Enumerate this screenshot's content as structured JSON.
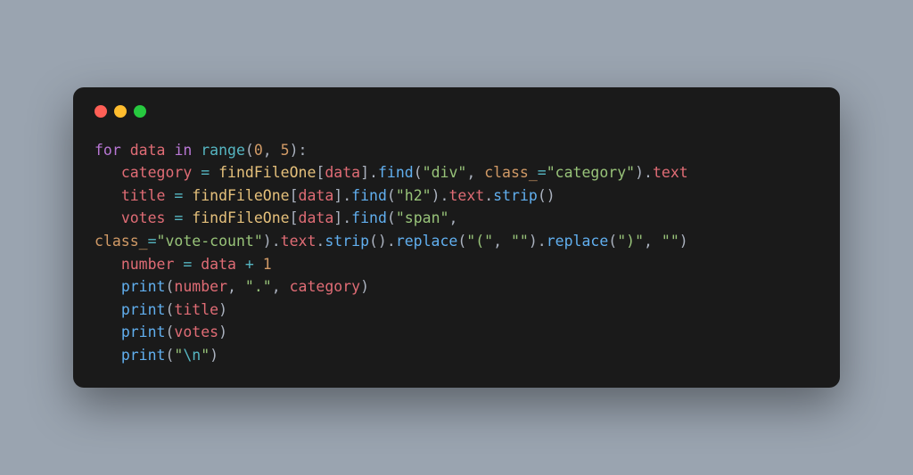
{
  "window": {
    "dots": [
      "red",
      "yellow",
      "green"
    ]
  },
  "code": {
    "tokens": [
      [
        {
          "text": "for",
          "cls": "kw-for"
        },
        {
          "text": " ",
          "cls": "punct"
        },
        {
          "text": "data",
          "cls": "var-data"
        },
        {
          "text": " ",
          "cls": "punct"
        },
        {
          "text": "in",
          "cls": "kw-in"
        },
        {
          "text": " ",
          "cls": "punct"
        },
        {
          "text": "range",
          "cls": "fn-range"
        },
        {
          "text": "(",
          "cls": "punct"
        },
        {
          "text": "0",
          "cls": "num"
        },
        {
          "text": ", ",
          "cls": "punct"
        },
        {
          "text": "5",
          "cls": "num"
        },
        {
          "text": "):",
          "cls": "punct"
        }
      ],
      [
        {
          "text": "   ",
          "cls": "punct"
        },
        {
          "text": "category",
          "cls": "var-name"
        },
        {
          "text": " ",
          "cls": "punct"
        },
        {
          "text": "=",
          "cls": "op"
        },
        {
          "text": " ",
          "cls": "punct"
        },
        {
          "text": "findFileOne",
          "cls": "obj"
        },
        {
          "text": "[",
          "cls": "punct"
        },
        {
          "text": "data",
          "cls": "var-data2"
        },
        {
          "text": "].",
          "cls": "punct"
        },
        {
          "text": "find",
          "cls": "method"
        },
        {
          "text": "(",
          "cls": "punct"
        },
        {
          "text": "\"div\"",
          "cls": "str"
        },
        {
          "text": ", ",
          "cls": "punct"
        },
        {
          "text": "class_",
          "cls": "kwarg"
        },
        {
          "text": "=",
          "cls": "op"
        },
        {
          "text": "\"category\"",
          "cls": "str"
        },
        {
          "text": ").",
          "cls": "punct"
        },
        {
          "text": "text",
          "cls": "attr"
        }
      ],
      [
        {
          "text": "   ",
          "cls": "punct"
        },
        {
          "text": "title",
          "cls": "var-name"
        },
        {
          "text": " ",
          "cls": "punct"
        },
        {
          "text": "=",
          "cls": "op"
        },
        {
          "text": " ",
          "cls": "punct"
        },
        {
          "text": "findFileOne",
          "cls": "obj"
        },
        {
          "text": "[",
          "cls": "punct"
        },
        {
          "text": "data",
          "cls": "var-data2"
        },
        {
          "text": "].",
          "cls": "punct"
        },
        {
          "text": "find",
          "cls": "method"
        },
        {
          "text": "(",
          "cls": "punct"
        },
        {
          "text": "\"h2\"",
          "cls": "str"
        },
        {
          "text": ").",
          "cls": "punct"
        },
        {
          "text": "text",
          "cls": "attr"
        },
        {
          "text": ".",
          "cls": "punct"
        },
        {
          "text": "strip",
          "cls": "method"
        },
        {
          "text": "()",
          "cls": "punct"
        }
      ],
      [
        {
          "text": "   ",
          "cls": "punct"
        },
        {
          "text": "votes",
          "cls": "var-name"
        },
        {
          "text": " ",
          "cls": "punct"
        },
        {
          "text": "=",
          "cls": "op"
        },
        {
          "text": " ",
          "cls": "punct"
        },
        {
          "text": "findFileOne",
          "cls": "obj"
        },
        {
          "text": "[",
          "cls": "punct"
        },
        {
          "text": "data",
          "cls": "var-data2"
        },
        {
          "text": "].",
          "cls": "punct"
        },
        {
          "text": "find",
          "cls": "method"
        },
        {
          "text": "(",
          "cls": "punct"
        },
        {
          "text": "\"span\"",
          "cls": "str"
        },
        {
          "text": ",",
          "cls": "punct"
        }
      ],
      [
        {
          "text": "class_",
          "cls": "kwarg"
        },
        {
          "text": "=",
          "cls": "op"
        },
        {
          "text": "\"vote-count\"",
          "cls": "str"
        },
        {
          "text": ").",
          "cls": "punct"
        },
        {
          "text": "text",
          "cls": "attr"
        },
        {
          "text": ".",
          "cls": "punct"
        },
        {
          "text": "strip",
          "cls": "method"
        },
        {
          "text": "().",
          "cls": "punct"
        },
        {
          "text": "replace",
          "cls": "method"
        },
        {
          "text": "(",
          "cls": "punct"
        },
        {
          "text": "\"(\"",
          "cls": "str"
        },
        {
          "text": ", ",
          "cls": "punct"
        },
        {
          "text": "\"\"",
          "cls": "str"
        },
        {
          "text": ").",
          "cls": "punct"
        },
        {
          "text": "replace",
          "cls": "method"
        },
        {
          "text": "(",
          "cls": "punct"
        },
        {
          "text": "\")\"",
          "cls": "str"
        },
        {
          "text": ", ",
          "cls": "punct"
        },
        {
          "text": "\"\"",
          "cls": "str"
        },
        {
          "text": ")",
          "cls": "punct"
        }
      ],
      [
        {
          "text": "   ",
          "cls": "punct"
        },
        {
          "text": "number",
          "cls": "var-name"
        },
        {
          "text": " ",
          "cls": "punct"
        },
        {
          "text": "=",
          "cls": "op"
        },
        {
          "text": " ",
          "cls": "punct"
        },
        {
          "text": "data",
          "cls": "var-data2"
        },
        {
          "text": " ",
          "cls": "punct"
        },
        {
          "text": "+",
          "cls": "op"
        },
        {
          "text": " ",
          "cls": "punct"
        },
        {
          "text": "1",
          "cls": "num"
        }
      ],
      [
        {
          "text": "   ",
          "cls": "punct"
        },
        {
          "text": "print",
          "cls": "fn-print"
        },
        {
          "text": "(",
          "cls": "punct"
        },
        {
          "text": "number",
          "cls": "var-name"
        },
        {
          "text": ", ",
          "cls": "punct"
        },
        {
          "text": "\".\"",
          "cls": "str"
        },
        {
          "text": ", ",
          "cls": "punct"
        },
        {
          "text": "category",
          "cls": "var-name"
        },
        {
          "text": ")",
          "cls": "punct"
        }
      ],
      [
        {
          "text": "   ",
          "cls": "punct"
        },
        {
          "text": "print",
          "cls": "fn-print"
        },
        {
          "text": "(",
          "cls": "punct"
        },
        {
          "text": "title",
          "cls": "var-name"
        },
        {
          "text": ")",
          "cls": "punct"
        }
      ],
      [
        {
          "text": "   ",
          "cls": "punct"
        },
        {
          "text": "print",
          "cls": "fn-print"
        },
        {
          "text": "(",
          "cls": "punct"
        },
        {
          "text": "votes",
          "cls": "var-name"
        },
        {
          "text": ")",
          "cls": "punct"
        }
      ],
      [
        {
          "text": "   ",
          "cls": "punct"
        },
        {
          "text": "print",
          "cls": "fn-print"
        },
        {
          "text": "(",
          "cls": "punct"
        },
        {
          "text": "\"",
          "cls": "str"
        },
        {
          "text": "\\n",
          "cls": "esc"
        },
        {
          "text": "\"",
          "cls": "str"
        },
        {
          "text": ")",
          "cls": "punct"
        }
      ]
    ]
  }
}
